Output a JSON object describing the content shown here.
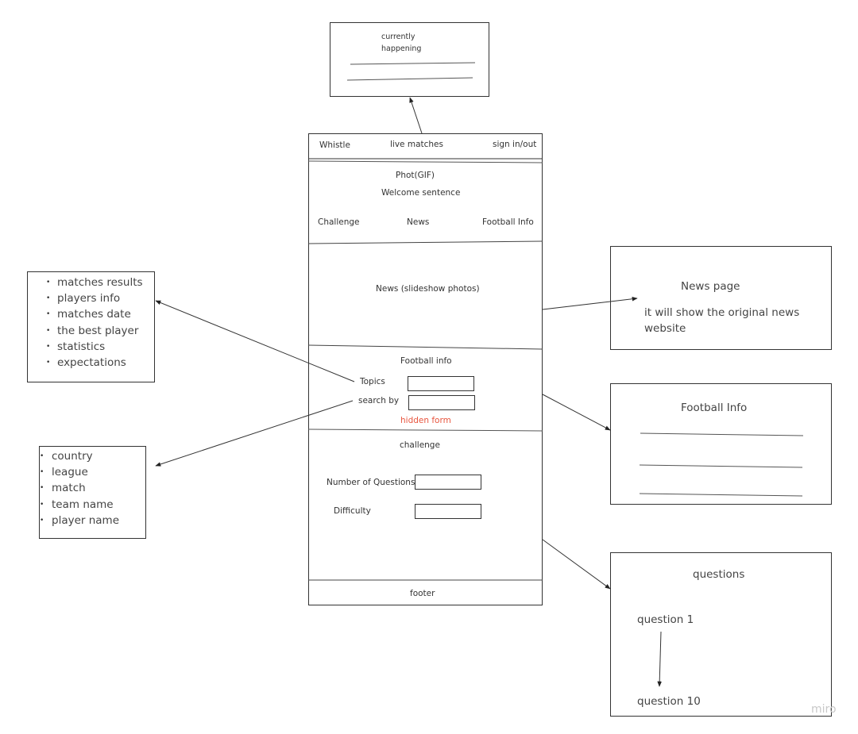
{
  "live_popup": {
    "title_line1": "currently",
    "title_line2": "happening"
  },
  "wireframe": {
    "navbar": {
      "logo": "Whistle",
      "live_matches": "live matches",
      "auth": "sign in/out"
    },
    "hero": {
      "media": "Phot(GIF)",
      "welcome": "Welcome sentence",
      "links": [
        "Challenge",
        "News",
        "Football Info"
      ]
    },
    "news_section": {
      "label": "News (slideshow photos)"
    },
    "football_info": {
      "title": "Football info",
      "topics_label": "Topics",
      "topics_value": "",
      "search_by_label": "search by",
      "search_by_value": "",
      "note": "hidden form",
      "note_color": "#e8553e"
    },
    "challenge": {
      "title": "challenge",
      "num_questions_label": "Number of Questions",
      "num_questions_value": "",
      "difficulty_label": "Difficulty",
      "difficulty_value": ""
    },
    "footer": {
      "label": "footer"
    }
  },
  "topics_list": {
    "items": [
      "matches results",
      "players info",
      "matches date",
      "the best player",
      "statistics",
      "expectations"
    ]
  },
  "search_by_list": {
    "items": [
      "country",
      "league",
      "match",
      "team name",
      "player name"
    ]
  },
  "news_page": {
    "title": "News page",
    "description": "it will show the original news website"
  },
  "football_info_page": {
    "title": "Football Info"
  },
  "questions_page": {
    "title": "questions",
    "first": "question 1",
    "last": "question 10"
  },
  "watermark": {
    "text": "miro",
    "color": "#c8c8c8"
  }
}
